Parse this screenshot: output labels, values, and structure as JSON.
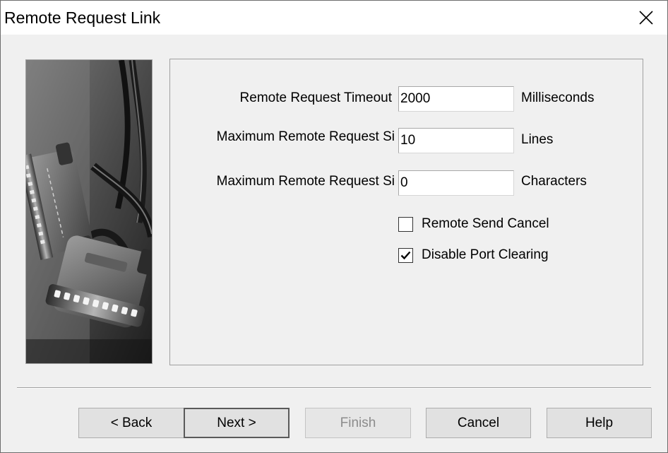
{
  "window": {
    "title": "Remote Request Link"
  },
  "form": {
    "timeout": {
      "label": "Remote Request Timeout",
      "value": "2000",
      "unit": "Milliseconds"
    },
    "max_size_lines": {
      "label": "Maximum Remote Request Si",
      "value": "10",
      "unit": "Lines"
    },
    "max_size_chars": {
      "label": "Maximum Remote Request Si",
      "value": "0",
      "unit": "Characters"
    },
    "remote_send_cancel": {
      "label": "Remote Send Cancel",
      "checked": false
    },
    "disable_port_clearing": {
      "label": "Disable Port Clearing",
      "checked": true
    }
  },
  "buttons": {
    "back": "< Back",
    "next": "Next >",
    "finish": "Finish",
    "cancel": "Cancel",
    "help": "Help"
  },
  "icons": {
    "close": "close-icon",
    "check": "checkmark-icon"
  },
  "colors": {
    "titlebar": "#ffffff",
    "dialog_bg": "#f0f0f0",
    "button_bg": "#e1e1e1",
    "disabled_text": "#8c8c8c"
  }
}
